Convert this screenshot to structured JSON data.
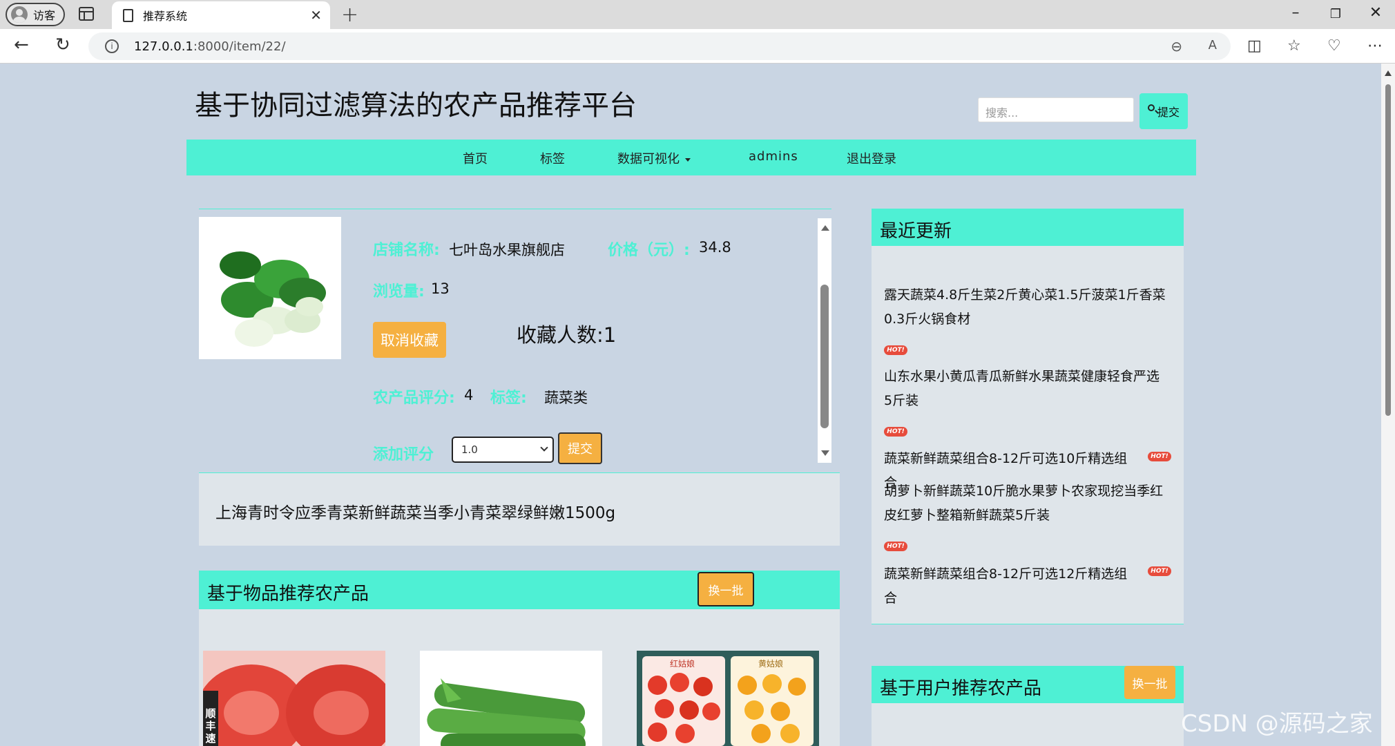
{
  "browser": {
    "profile_label": "访客",
    "tab_title": "推荐系统",
    "url_host": "127.0.0.1",
    "url_rest": ":8000/item/22/"
  },
  "site": {
    "title": "基于协同过滤算法的农产品推荐平台",
    "search_placeholder": "搜索...",
    "search_button": "提交"
  },
  "nav": {
    "home": "首页",
    "tags": "标签",
    "dataviz": "数据可视化",
    "user": "admins",
    "logout": "退出登录"
  },
  "product": {
    "shop_label": "店铺名称:",
    "shop_value": "七叶岛水果旗舰店",
    "price_label": "价格（元）:",
    "price_value": "34.8",
    "views_label": "浏览量:",
    "views_value": "13",
    "unfavorite_button": "取消收藏",
    "favorites_text": "收藏人数:1",
    "rating_label": "农产品评分:",
    "rating_value": "4",
    "tag_label": "标签:",
    "tag_value": "蔬菜类",
    "add_rating_label": "添加评分",
    "rating_select_value": "1.0",
    "rating_submit": "提交",
    "description": "上海青时令应季青菜新鲜蔬菜当季小青菜翠绿鲜嫩1500g"
  },
  "item_recs": {
    "title": "基于物品推荐农产品",
    "swap_button": "换一批",
    "thumb3_label_left": "红姑娘",
    "thumb3_label_right": "黄姑娘",
    "thumb1_badge": "顺丰速"
  },
  "recent": {
    "title": "最近更新",
    "hot_label": "HOT!",
    "items": [
      "露天蔬菜4.8斤生菜2斤黄心菜1.5斤菠菜1斤香菜0.3斤火锅食材",
      "山东水果小黄瓜青瓜新鲜水果蔬菜健康轻食严选5斤装",
      "蔬菜新鲜蔬菜组合8-12斤可选10斤精选组合",
      "胡萝卜新鲜蔬菜10斤脆水果萝卜农家现挖当季红皮红萝卜整箱新鲜蔬菜5斤装",
      "蔬菜新鲜蔬菜组合8-12斤可选12斤精选组合"
    ]
  },
  "user_recs": {
    "title": "基于用户推荐农产品",
    "swap_button": "换一批"
  },
  "watermark": "CSDN @源码之家"
}
